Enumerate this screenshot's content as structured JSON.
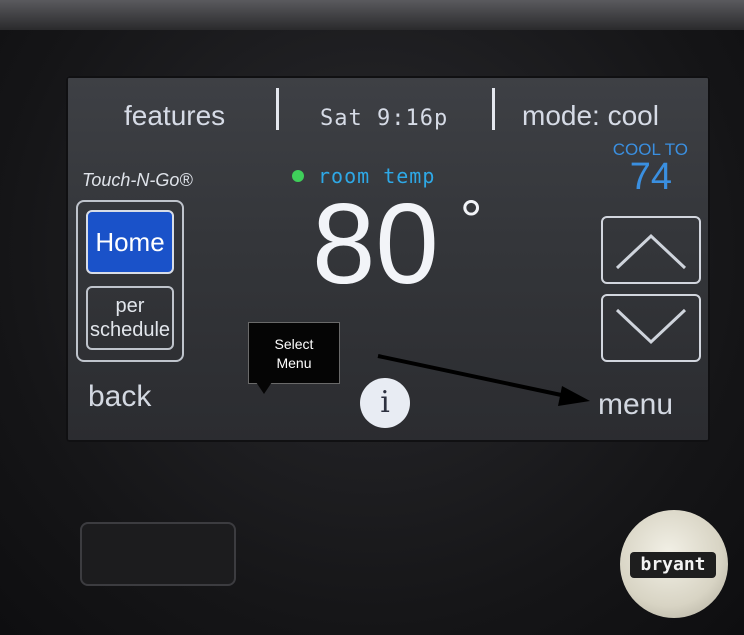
{
  "topbar": {
    "features_label": "features",
    "clock": "Sat 9:16p",
    "mode_label": "mode: cool"
  },
  "brand": {
    "touch_n_go": "Touch-N-Go®"
  },
  "modes": {
    "home_label": "Home",
    "schedule_line1": "per",
    "schedule_line2": "schedule"
  },
  "status": {
    "room_label": "room temp",
    "dot_color": "#3fcf5a",
    "room_temp": "80",
    "degree_symbol": "°"
  },
  "setpoint": {
    "cool_label": "COOL TO",
    "cool_value": "74"
  },
  "controls": {
    "up_icon": "chevron-up-icon",
    "down_icon": "chevron-down-icon",
    "back_label": "back",
    "info_label": "i",
    "menu_label": "menu"
  },
  "annotation": {
    "line1": "Select",
    "line2": "Menu"
  },
  "logo": {
    "text": "bryant"
  },
  "colors": {
    "accent": "#1a52c9",
    "setpoint": "#3a8fe0",
    "room_label": "#2ea8e6"
  }
}
